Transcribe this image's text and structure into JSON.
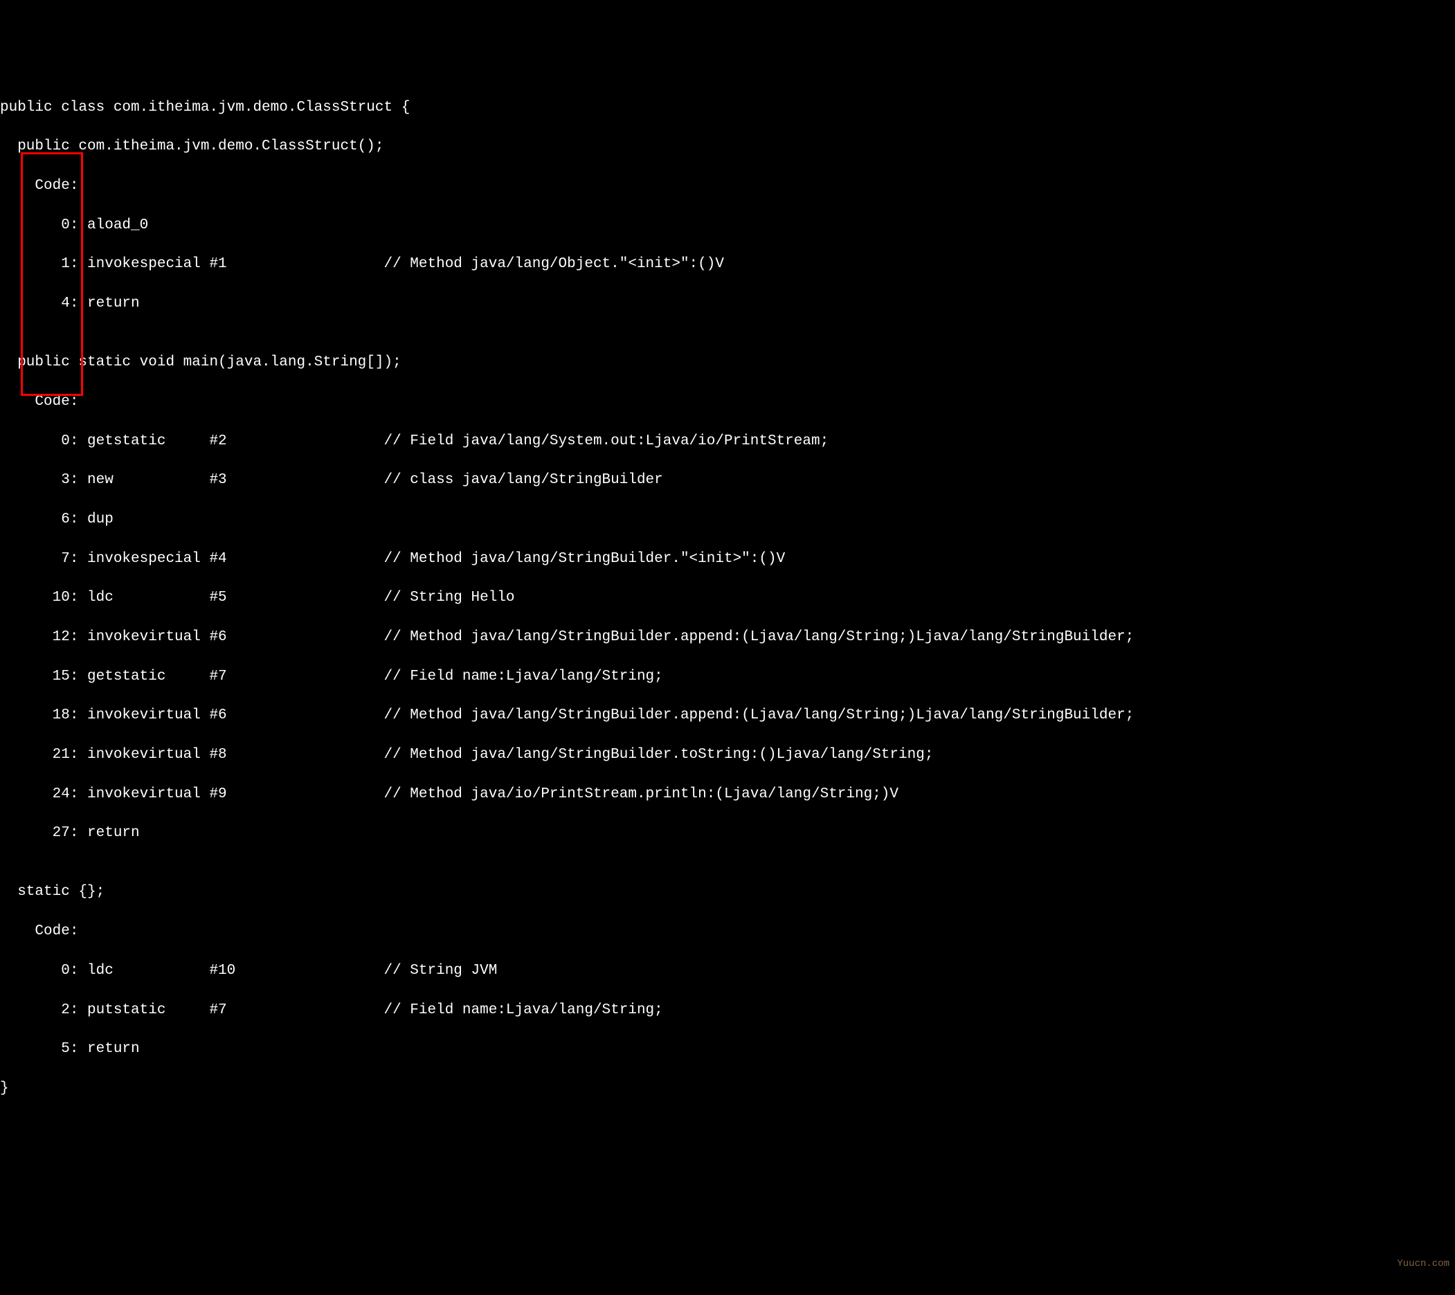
{
  "watermark": "Yuucn.com",
  "lines": {
    "l0": "public class com.itheima.jvm.demo.ClassStruct {",
    "l1": "  public com.itheima.jvm.demo.ClassStruct();",
    "l2": "    Code:",
    "l3": "       0: aload_0",
    "l4": "       1: invokespecial #1                  // Method java/lang/Object.\"<init>\":()V",
    "l5": "       4: return",
    "l6": "",
    "l7": "  public static void main(java.lang.String[]);",
    "l8": "    Code:",
    "l9": "       0: getstatic     #2                  // Field java/lang/System.out:Ljava/io/PrintStream;",
    "l10": "       3: new           #3                  // class java/lang/StringBuilder",
    "l11": "       6: dup",
    "l12": "       7: invokespecial #4                  // Method java/lang/StringBuilder.\"<init>\":()V",
    "l13": "      10: ldc           #5                  // String Hello",
    "l14": "      12: invokevirtual #6                  // Method java/lang/StringBuilder.append:(Ljava/lang/String;)Ljava/lang/StringBuilder;",
    "l15": "      15: getstatic     #7                  // Field name:Ljava/lang/String;",
    "l16": "      18: invokevirtual #6                  // Method java/lang/StringBuilder.append:(Ljava/lang/String;)Ljava/lang/StringBuilder;",
    "l17": "      21: invokevirtual #8                  // Method java/lang/StringBuilder.toString:()Ljava/lang/String;",
    "l18": "      24: invokevirtual #9                  // Method java/io/PrintStream.println:(Ljava/lang/String;)V",
    "l19": "      27: return",
    "l20": "",
    "l21": "  static {};",
    "l22": "    Code:",
    "l23": "       0: ldc           #10                 // String JVM",
    "l24": "       2: putstatic     #7                  // Field name:Ljava/lang/String;",
    "l25": "       5: return",
    "l26": "}"
  }
}
